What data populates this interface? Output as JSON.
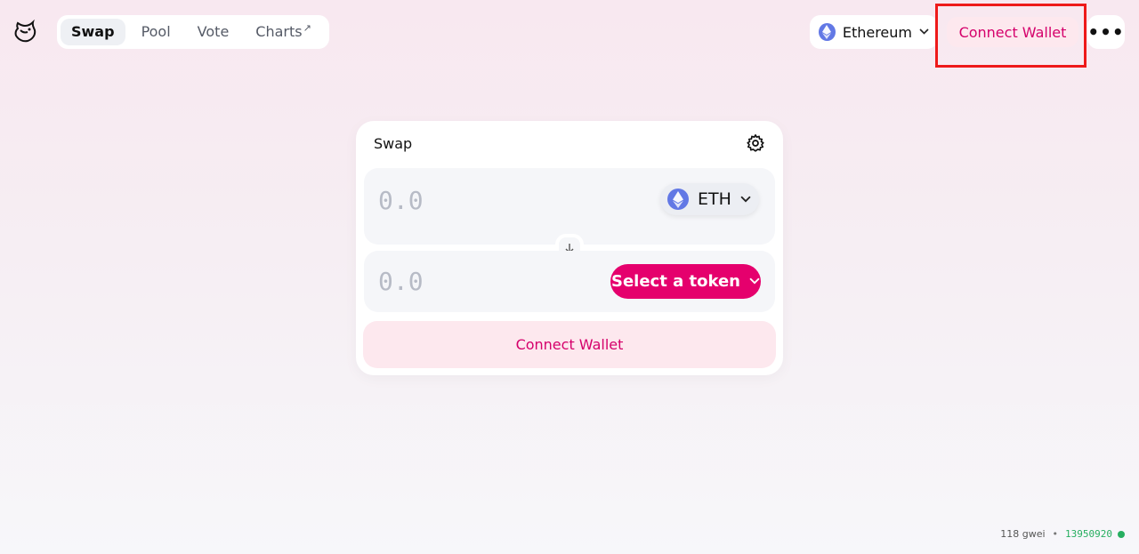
{
  "nav": {
    "items": [
      {
        "label": "Swap",
        "active": true
      },
      {
        "label": "Pool",
        "active": false
      },
      {
        "label": "Vote",
        "active": false
      },
      {
        "label": "Charts",
        "active": false,
        "external": true
      }
    ],
    "external_glyph": "↗"
  },
  "header": {
    "network_label": "Ethereum",
    "connect_label": "Connect Wallet",
    "more_label": "•••"
  },
  "swap": {
    "title": "Swap",
    "input": {
      "amount": "0.0",
      "token": "ETH"
    },
    "output": {
      "amount": "0.0",
      "select_label": "Select a token"
    },
    "connect_label": "Connect Wallet"
  },
  "footer": {
    "gas": "118 gwei",
    "separator": "•",
    "block": "13950920"
  },
  "colors": {
    "accent": "#e5006d",
    "accent_soft": "#fde8ee",
    "eth": "#6278e5",
    "status": "#27ae60"
  }
}
